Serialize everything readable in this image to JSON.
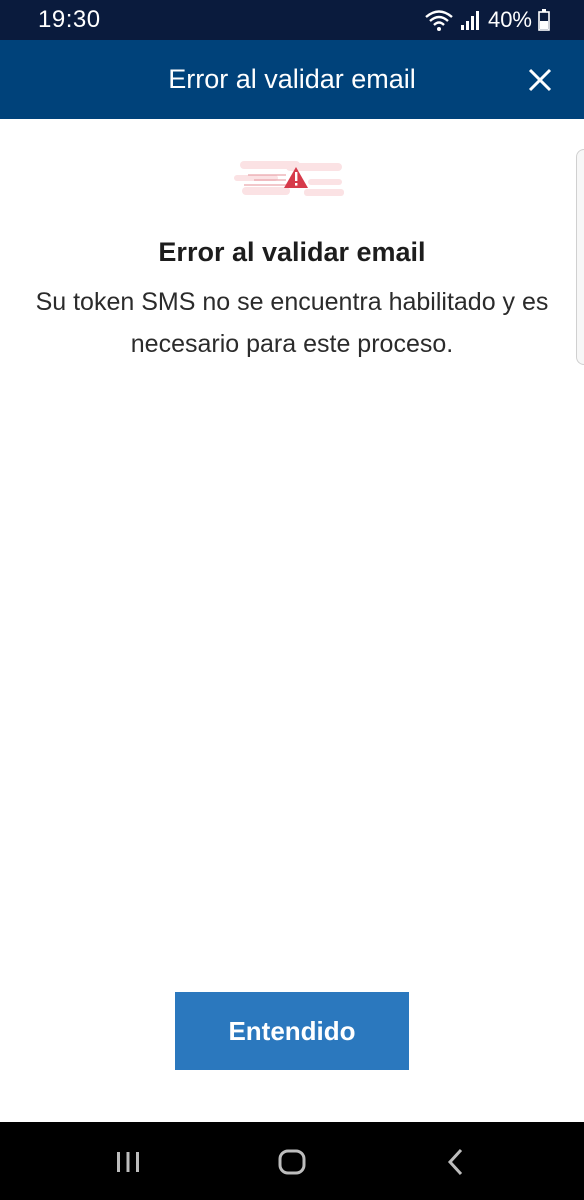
{
  "status_bar": {
    "time": "19:30",
    "battery_percent": "40%",
    "icons": [
      "wifi-icon",
      "signal-icon",
      "battery-icon"
    ]
  },
  "header": {
    "title": "Error al validar email",
    "close_icon": "close-icon"
  },
  "error": {
    "illustration": "warning-icon",
    "title": "Error al validar email",
    "message": "Su token SMS no se encuentra habilitado y es necesario para este proceso."
  },
  "actions": {
    "confirm_label": "Entendido"
  },
  "nav_bar": {
    "items": [
      "recent-apps-icon",
      "home-icon",
      "back-icon"
    ]
  },
  "colors": {
    "status_bar": "#0a1b3d",
    "header": "#00427a",
    "button": "#2b78be",
    "warning": "#d63a4a"
  }
}
